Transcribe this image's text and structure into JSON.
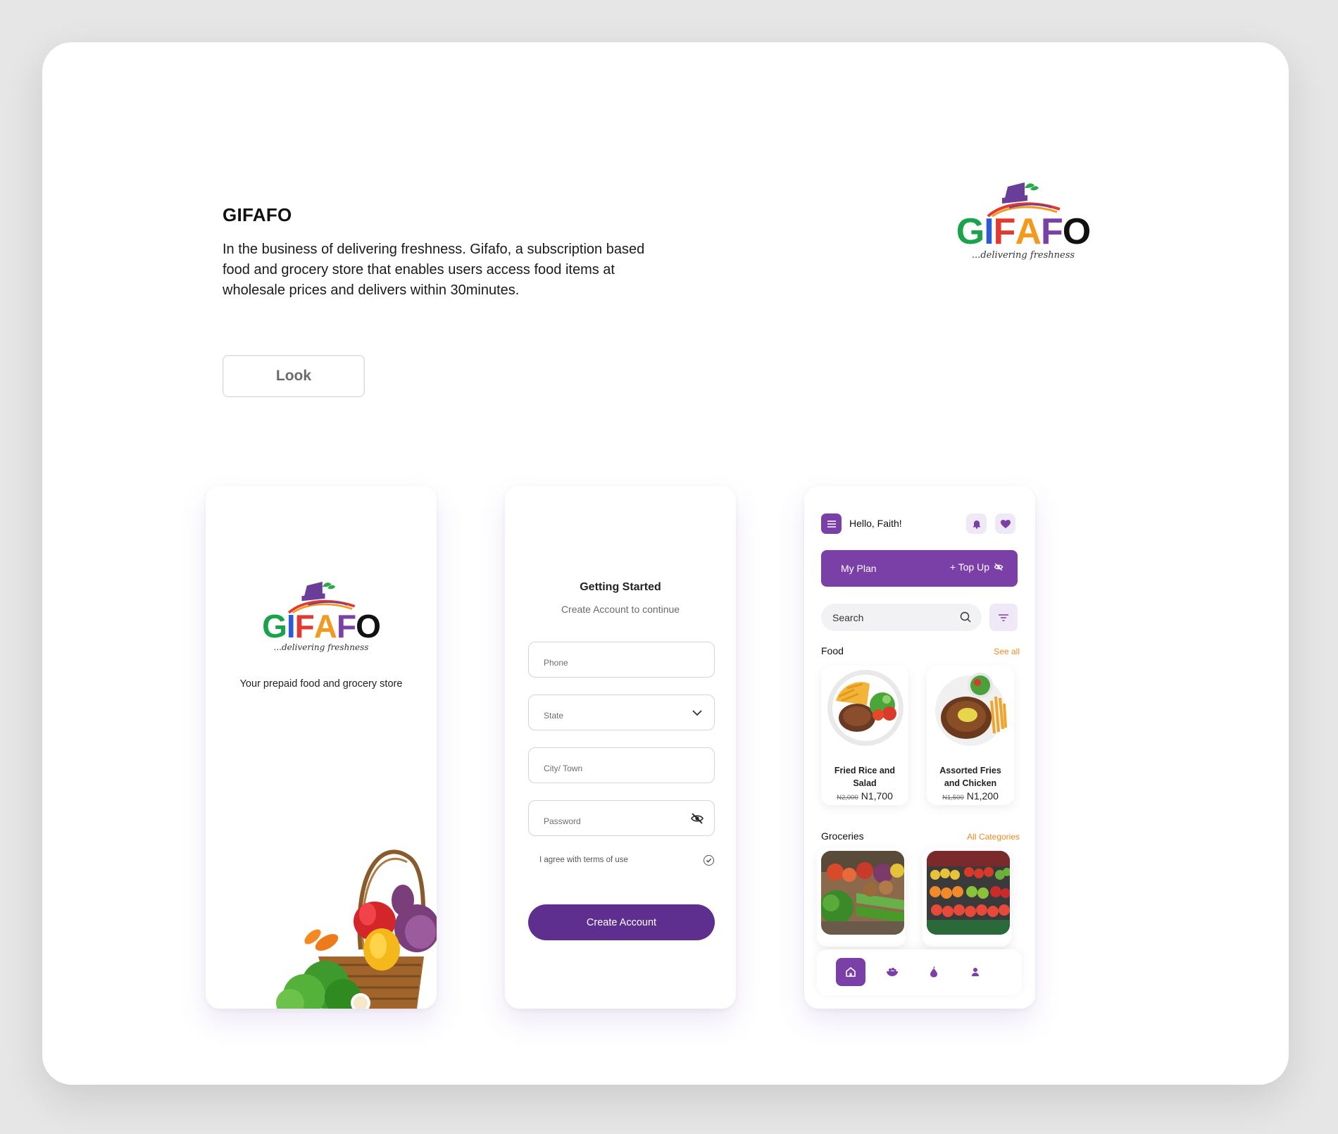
{
  "project": {
    "title": "GIFAFO",
    "description": "In the business of delivering freshness. Gifafo, a subscription based food and grocery store that enables users access food items at wholesale prices and delivers within 30minutes.",
    "look_button": "Look"
  },
  "brand": {
    "letters": [
      "G",
      "I",
      "F",
      "A",
      "F",
      "O"
    ],
    "letter_colors": [
      "#1aa34a",
      "#2b5bd7",
      "#e23a2e",
      "#f39a1e",
      "#7b3fa8",
      "#111111"
    ],
    "tagline": "...delivering freshness",
    "accent": "#5e2f8e",
    "accent_light": "#7b3fa8",
    "orange": "#f08a24"
  },
  "splash": {
    "subtitle": "Your prepaid food and grocery store"
  },
  "signup": {
    "heading": "Getting Started",
    "subheading": "Create Account to continue",
    "fields": {
      "phone": "Phone",
      "state": "State",
      "city": "City/ Town",
      "password": "Password"
    },
    "terms": "I agree with terms of use",
    "button": "Create Account"
  },
  "home": {
    "greeting": "Hello, Faith!",
    "plan_label": "My Plan",
    "topup_label": "+ Top Up",
    "search_placeholder": "Search",
    "food_section": "Food",
    "see_all": "See all",
    "foods": [
      {
        "name": "Fried Rice and Salad",
        "old_price": "N2,000",
        "price": "N1,700"
      },
      {
        "name": "Assorted Fries and Chicken",
        "old_price": "N1,500",
        "price": "N1,200"
      }
    ],
    "groceries_section": "Groceries",
    "all_categories": "All Categories",
    "nav": [
      "home-icon",
      "food-bowl-icon",
      "fruit-icon",
      "profile-icon"
    ]
  }
}
